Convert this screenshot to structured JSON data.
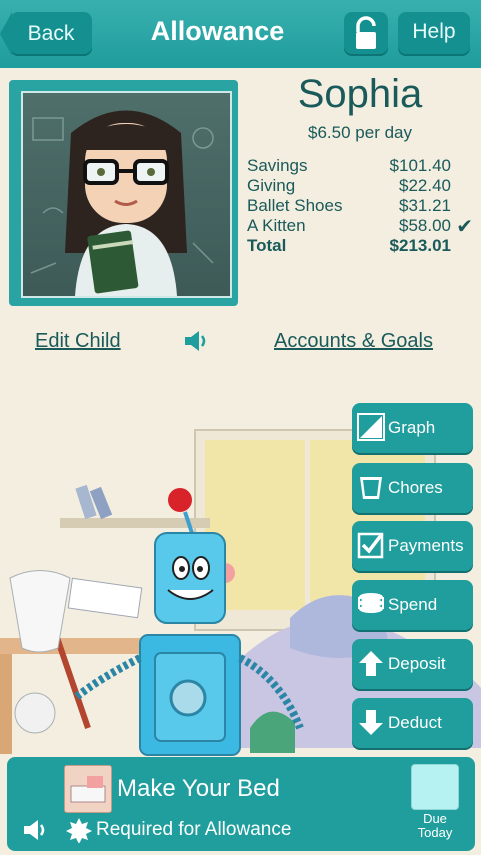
{
  "header": {
    "back_label": "Back",
    "title": "Allowance",
    "help_label": "Help",
    "lock_icon": "lock-icon"
  },
  "child": {
    "name": "Sophia",
    "rate": "$6.50 per day"
  },
  "accounts": [
    {
      "name": "Savings",
      "amount": "$101.40",
      "checked": false
    },
    {
      "name": "Giving",
      "amount": "$22.40",
      "checked": false
    },
    {
      "name": "Ballet Shoes",
      "amount": "$31.21",
      "checked": false
    },
    {
      "name": "A Kitten",
      "amount": "$58.00",
      "checked": true
    }
  ],
  "total": {
    "label": "Total",
    "amount": "$213.01"
  },
  "links": {
    "edit_child": "Edit Child",
    "accounts_goals": "Accounts & Goals"
  },
  "menu": [
    {
      "label": "Graph",
      "icon": "graph-icon"
    },
    {
      "label": "Chores",
      "icon": "cup-icon"
    },
    {
      "label": "Payments",
      "icon": "checkbox-icon"
    },
    {
      "label": "Spend",
      "icon": "coins-icon"
    },
    {
      "label": "Deposit",
      "icon": "arrow-up-icon"
    },
    {
      "label": "Deduct",
      "icon": "arrow-down-icon"
    }
  ],
  "chore": {
    "title": "Make Your Bed",
    "subtitle": "Required for Allowance",
    "due_line1": "Due",
    "due_line2": "Today"
  },
  "colors": {
    "teal": "#1f9e9d",
    "dark_teal": "#13908f",
    "text_dark": "#1a5a5a",
    "background": "#f4eee0"
  }
}
